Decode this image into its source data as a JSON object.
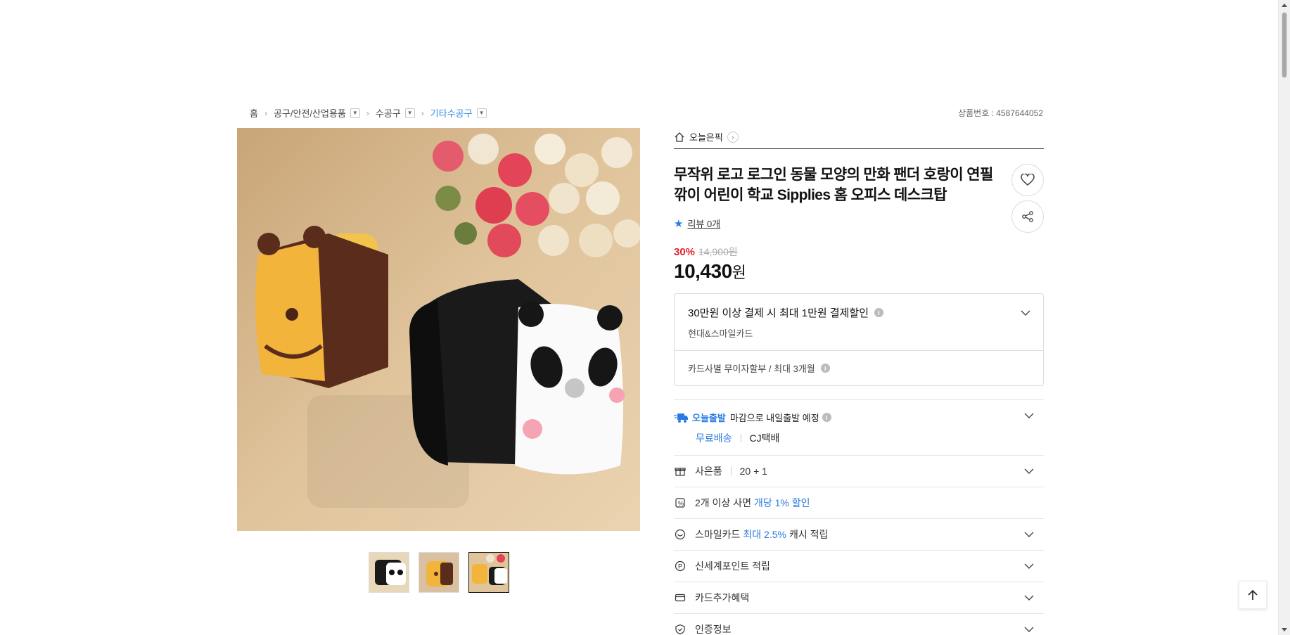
{
  "breadcrumb": {
    "home": "홈",
    "cat1": "공구/안전/산업용품",
    "cat2": "수공구",
    "cat3": "기타수공구"
  },
  "product_number": "상품번호 : 4587644052",
  "store": {
    "name": "오늘은픽"
  },
  "product": {
    "title": "무작위 로고 로그인 동물 모양의 만화 팬더 호랑이 연필 깎이 어린이 학교 Sipplies 홈 오피스 데스크탑",
    "review_label": "리뷰 0개",
    "discount_rate": "30%",
    "original_price": "14,900원",
    "price_number": "10,430",
    "price_unit": "원"
  },
  "card_benefit": {
    "headline": "30만원 이상 결제 시 최대 1만원 결제할인",
    "cards": "현대&스마일카드",
    "installment": "카드사별 무이자할부 / 최대 3개월"
  },
  "shipping": {
    "badge": "오늘출발",
    "text": "마감으로 내일출발 예정",
    "fee": "무료배송",
    "carrier": "CJ택배"
  },
  "rows": {
    "gift_label": "사은품",
    "gift_value": "20 + 1",
    "multi_prefix": "2개 이상 사면",
    "multi_accent": "개당 1% 할인",
    "smile_prefix": "스마일카드",
    "smile_accent": "최대 2.5%",
    "smile_suffix": "캐시 적립",
    "ssg_point": "신세계포인트 적립",
    "card_extra": "카드추가혜택",
    "cert": "인증정보"
  },
  "colors": {
    "accent": "#2a7ae2",
    "discount": "#e2202b",
    "breadcrumb_active": "#2f8be6"
  },
  "icons": [
    "home-icon",
    "heart-icon",
    "share-icon",
    "star-icon",
    "chevron-down-icon",
    "truck-icon",
    "gift-icon",
    "discount-tag-icon",
    "smile-icon",
    "point-icon",
    "card-icon",
    "shield-icon",
    "arrow-up-icon"
  ]
}
